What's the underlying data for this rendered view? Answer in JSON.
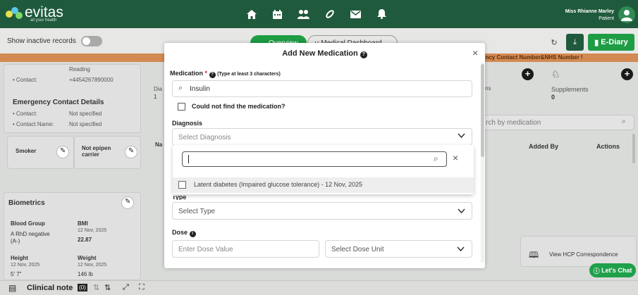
{
  "brand": {
    "name": "evitas",
    "tagline": "all your health"
  },
  "user": {
    "name": "Miss Rhianne Marley",
    "role": "Patient"
  },
  "toolbar": {
    "show_inactive": "Show inactive records",
    "tab_overview": "Overview",
    "tab_dashboard": "Medical Dashboard",
    "ediary": "E-Diary"
  },
  "banner": "ency Contact Number&NHS Number !",
  "left": {
    "reading_label": "Reading",
    "contact_label": "• Contact:",
    "contact_value": "+4454267890000",
    "emergency_title": "Emergency Contact Details",
    "ec_contact_label": "• Contact:",
    "ec_contact_value": "Not specified",
    "ec_name_label": "• Contact Name:",
    "ec_name_value": "Not specified",
    "smoker": "Smoker",
    "epipen_1": "Not epipen",
    "epipen_2": "carrier",
    "biometrics": "Biometrics",
    "blood_group_label": "Blood Group",
    "blood_group_value": "A RhD negative",
    "blood_group_value2": "(A-)",
    "bmi_label": "BMI",
    "bmi_date": "12 Nov, 2025",
    "bmi_value": "22.87",
    "height_label": "Height",
    "height_date": "12 Nov, 2025",
    "height_value": "5' 7\"",
    "weight_label": "Weight",
    "weight_date": "12 Nov, 2025",
    "weight_value": "146 lb"
  },
  "center": {
    "dia": "Dia",
    "one": "1",
    "na": "Na",
    "ns": "ns"
  },
  "right": {
    "supplements": "Supplements",
    "supplements_count": "0",
    "search_placeholder": "rch by medication",
    "col_added_by": "Added By",
    "col_actions": "Actions",
    "hcp": "View HCP Correspondence",
    "chat": "Let's Chat"
  },
  "bottom": {
    "clinical_note": "Clinical note",
    "count": "(0)"
  },
  "modal": {
    "title": "Add New Medication",
    "close": "×",
    "medication_label": "Medication",
    "required": "*",
    "medication_hint": "(Type at least 3 characters)",
    "medication_value": "Insulin",
    "not_found": "Could not find the medication?",
    "diagnosis_label": "Diagnosis",
    "diagnosis_placeholder": "Select Diagnosis",
    "dd_option": "Latent diabetes (Impaired glucose tolerance)  - 12 Nov, 2025",
    "type_label": "Type",
    "type_placeholder": "Select Type",
    "dose_label": "Dose",
    "dose_placeholder": "Enter Dose Value",
    "dose_unit_placeholder": "Select Dose Unit"
  },
  "colors": {
    "brand_dark": "#1f5a3c",
    "accent": "#1e9d44",
    "banner": "#d38a52"
  }
}
